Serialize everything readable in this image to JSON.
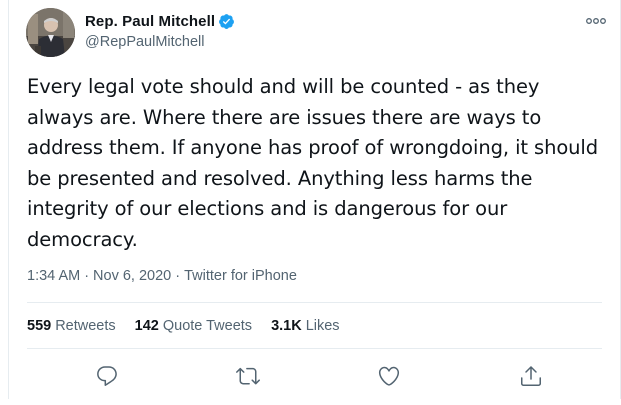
{
  "tweet": {
    "author": {
      "display_name": "Rep. Paul Mitchell",
      "handle": "@RepPaulMitchell",
      "verified": true,
      "avatar_icon": "profile-photo"
    },
    "text": "Every legal vote should and will be counted - as they always are. Where there are issues there are ways to address them. If anyone has proof of wrongdoing, it should be presented and resolved. Anything less harms the integrity of our elections and is dangerous for our democracy.",
    "time": "1:34 AM",
    "date": "Nov 6, 2020",
    "source": "Twitter for iPhone",
    "separator": "·"
  },
  "stats": {
    "retweets": {
      "count": "559",
      "label": "Retweets"
    },
    "quote_tweets": {
      "count": "142",
      "label": "Quote Tweets"
    },
    "likes": {
      "count": "3.1K",
      "label": "Likes"
    }
  },
  "actions": [
    {
      "name": "reply",
      "icon": "reply-icon"
    },
    {
      "name": "retweet",
      "icon": "retweet-icon"
    },
    {
      "name": "like",
      "icon": "heart-icon"
    },
    {
      "name": "share",
      "icon": "share-icon"
    }
  ],
  "colors": {
    "primary_text": "#0f1419",
    "secondary_text": "#536471",
    "verified_blue": "#1da1f2",
    "divider": "#e6ecf0"
  }
}
